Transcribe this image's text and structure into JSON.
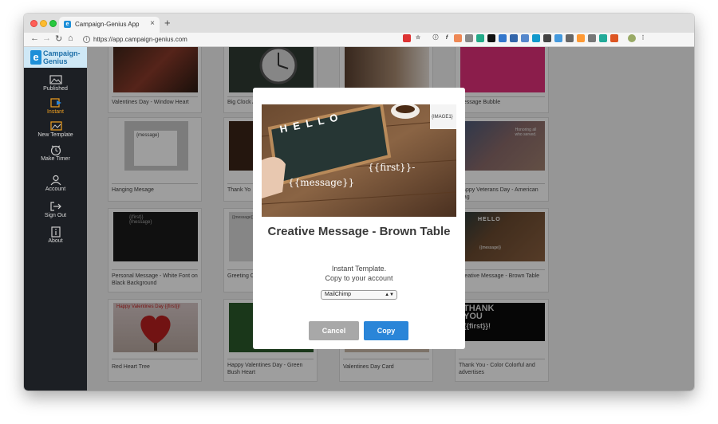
{
  "browser": {
    "tab_title": "Campaign-Genius App",
    "tab_close": "×",
    "new_tab": "+",
    "url": "https://app.campaign-genius.com"
  },
  "sidebar": {
    "logo_text": "Campaign-Genius",
    "items": [
      {
        "label": "Published",
        "icon": "image-icon"
      },
      {
        "label": "Instant",
        "icon": "instant-icon",
        "active": true
      },
      {
        "label": "New Template",
        "icon": "new-template-icon"
      },
      {
        "label": "Make Timer",
        "icon": "timer-icon"
      },
      {
        "label": "Account",
        "icon": "user-icon"
      },
      {
        "label": "Sign Out",
        "icon": "sign-out-icon"
      },
      {
        "label": "About",
        "icon": "info-icon"
      }
    ]
  },
  "cards": [
    {
      "caption": "Valentines Day - Window Heart"
    },
    {
      "caption": "Big Clock Anniversa"
    },
    {
      "caption": ""
    },
    {
      "caption": "Message Bubble"
    },
    {
      "caption": "Hanging Mesage"
    },
    {
      "caption": "Thank Yo"
    },
    {
      "caption": ""
    },
    {
      "caption": "Happy Veterans Day - American Flag"
    },
    {
      "caption": "Personal Message - White Font on Black Background"
    },
    {
      "caption": "Greeting Crumble"
    },
    {
      "caption": ""
    },
    {
      "caption": "Creative Message - Brown Table"
    },
    {
      "caption": "Red Heart Tree"
    },
    {
      "caption": "Happy Valentines Day - Green Bush Heart"
    },
    {
      "caption": "Valentines Day Card"
    },
    {
      "caption": "Thank You - Color Colorful and advertises"
    }
  ],
  "thumb_text": {
    "hanging": "{message}",
    "personal": "{{first}}\n{message}",
    "greeting": "{{message}}",
    "veterans": "Honoring all who served.",
    "red_heart": "Happy Valentines Day {{first}}!",
    "thank_you_big": "THANK YOU",
    "thank_you_first": "{{first}}!",
    "creative_hello": "HELLO",
    "creative_msg": "{{message}}"
  },
  "modal": {
    "image_text": {
      "hello": "H E L L O",
      "first": "{{first}}-",
      "message": "{{message}}",
      "image_tag": "{IMAGE1}"
    },
    "title": "Creative Message - Brown Table",
    "desc_line1": "Instant Template.",
    "desc_line2": "Copy to your account",
    "select_value": "MailChimp",
    "cancel_label": "Cancel",
    "copy_label": "Copy"
  }
}
